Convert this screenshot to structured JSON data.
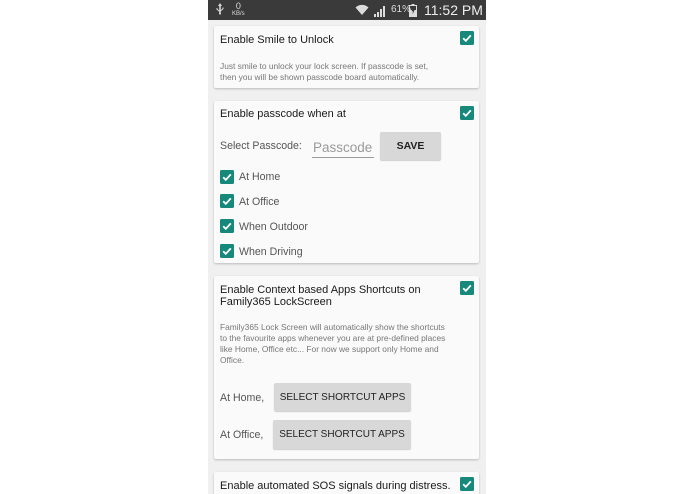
{
  "status_bar": {
    "usb_icon": "usb-icon",
    "speed_value": "0",
    "speed_unit": "KB/s",
    "wifi_icon": "wifi-icon",
    "signal_icon": "cell-signal-icon",
    "battery_percent": "61%",
    "battery_icon": "battery-charging-icon",
    "time": "11:52 PM"
  },
  "smile_card": {
    "title": "Enable Smile to Unlock",
    "checked": true,
    "description_line1": "Just smile to unlock your lock screen. If passcode is set,",
    "description_line2": "then you will be shown passcode board automatically."
  },
  "passcode_card": {
    "title": "Enable passcode when at",
    "checked": true,
    "select_label": "Select Passcode:",
    "passcode_placeholder": "Passcode",
    "save_label": "SAVE",
    "options": [
      {
        "label": "At Home",
        "checked": true
      },
      {
        "label": "At Office",
        "checked": true
      },
      {
        "label": "When Outdoor",
        "checked": true
      },
      {
        "label": "When Driving",
        "checked": true
      }
    ]
  },
  "shortcuts_card": {
    "title_line1": "Enable Context based Apps Shortcuts on",
    "title_line2": "Family365 LockScreen",
    "checked": true,
    "description_line1": "Family365 Lock Screen will automatically show the shortcuts",
    "description_line2": "to the favourite apps whenever you are at pre-defined places",
    "description_line3": "like Home, Office etc... For now we support only Home and",
    "description_line4": "Office.",
    "home_label": "At Home,",
    "office_label": "At Office,",
    "home_button": "SELECT SHORTCUT APPS",
    "office_button": "SELECT SHORTCUT APPS"
  },
  "sos_card": {
    "title": "Enable automated SOS signals during distress.",
    "checked": true
  },
  "colors": {
    "accent": "#16897b",
    "status_bar": "#3a3a3a",
    "background": "#f0f0f0"
  }
}
